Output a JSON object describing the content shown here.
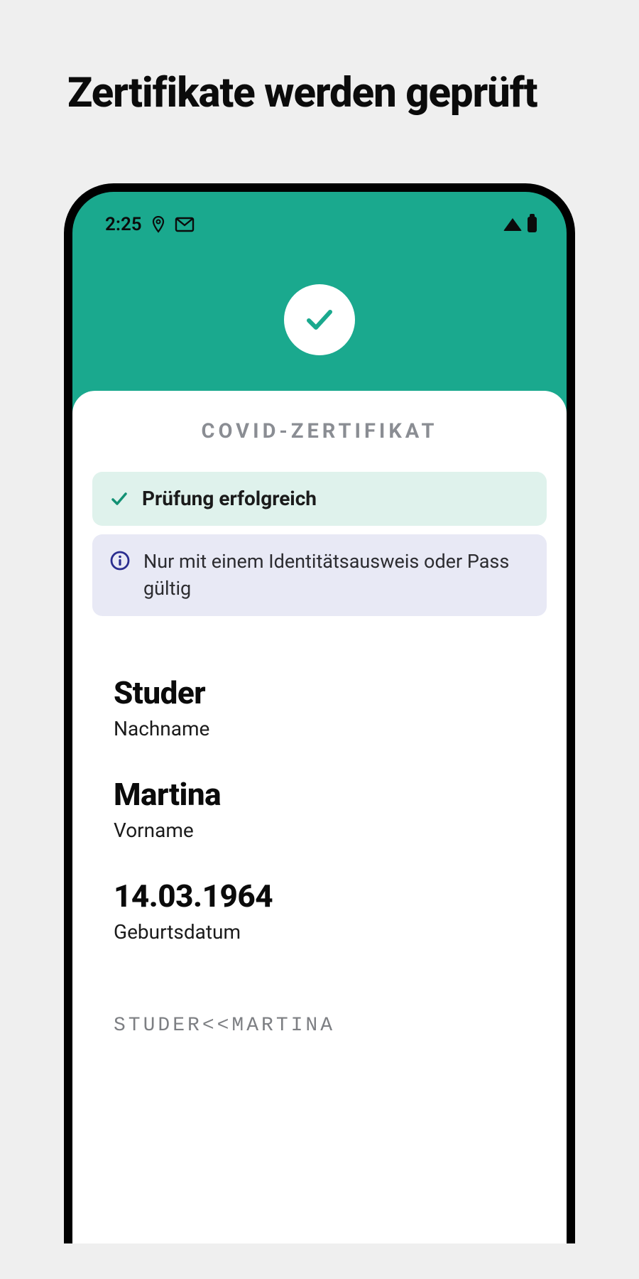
{
  "page": {
    "title": "Zertifikate werden geprüft"
  },
  "statusBar": {
    "time": "2:25"
  },
  "colors": {
    "accent": "#1aa98e",
    "infoIcon": "#2a2d8f"
  },
  "card": {
    "heading": "COVID-ZERTIFIKAT",
    "successText": "Prüfung erfolgreich",
    "infoText": "Nur mit einem Identitätsausweis oder Pass gültig"
  },
  "details": {
    "lastname": {
      "value": "Studer",
      "label": "Nachname"
    },
    "firstname": {
      "value": "Martina",
      "label": "Vorname"
    },
    "birthdate": {
      "value": "14.03.1964",
      "label": "Geburtsdatum"
    }
  },
  "mrz": "STUDER<<MARTINA"
}
